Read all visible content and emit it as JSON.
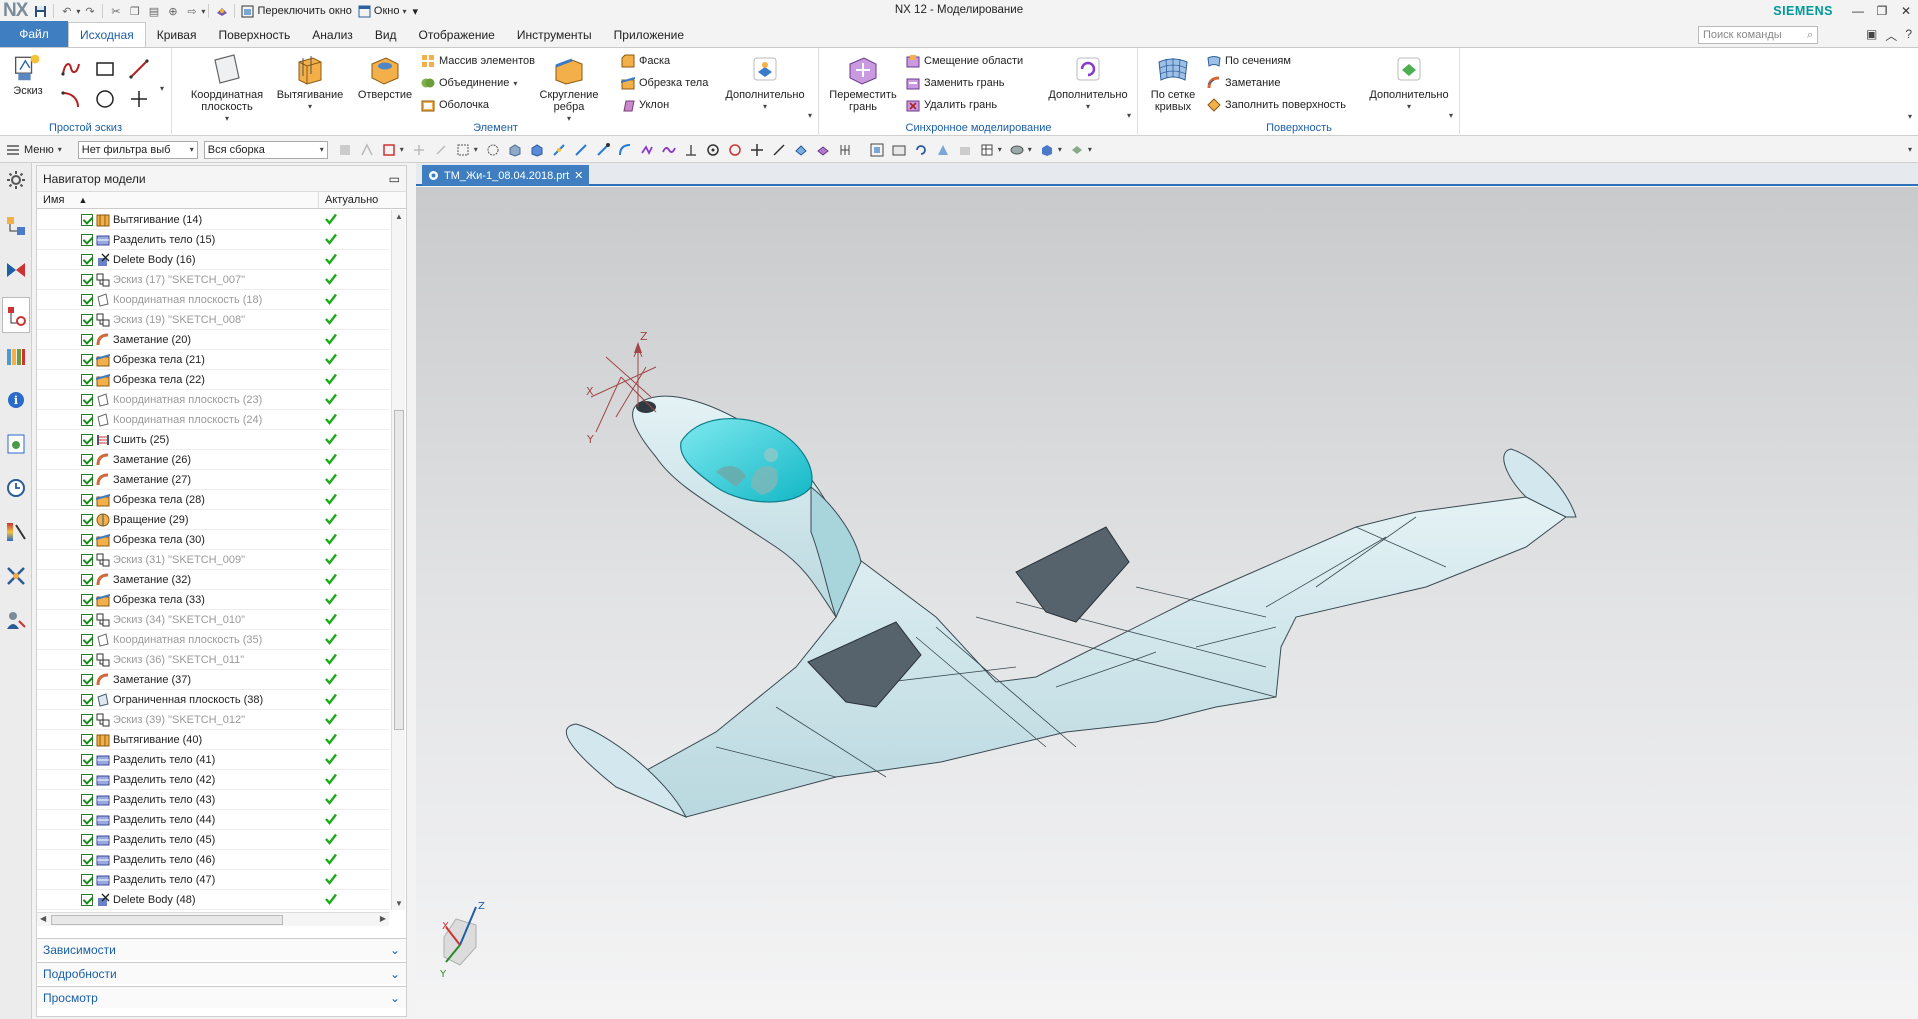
{
  "app": {
    "logo": "NX",
    "title": "NX 12 - Моделирование",
    "brand": "SIEMENS",
    "switch_window": "Переключить окно",
    "window_menu": "Окно"
  },
  "tabs": {
    "file": "Файл",
    "items": [
      "Исходная",
      "Кривая",
      "Поверхность",
      "Анализ",
      "Вид",
      "Отображение",
      "Инструменты",
      "Приложение"
    ],
    "active": "Исходная",
    "command_search_placeholder": "Поиск команды"
  },
  "ribbon": {
    "sketch_group": {
      "label": "Простой эскиз",
      "sketch_button": "Эскиз"
    },
    "feature_group": {
      "label": "Элемент",
      "datum_plane": "Координатная плоскость",
      "extrude": "Вытягивание",
      "hole": "Отверстие",
      "pattern": "Массив элементов",
      "unite": "Объединение",
      "shell": "Оболочка",
      "edge_blend": "Скругление ребра",
      "chamfer": "Фаска",
      "trim_body": "Обрезка тела",
      "draft": "Уклон",
      "more": "Дополнительно"
    },
    "sync_group": {
      "label": "Синхронное моделирование",
      "move_face": "Переместить грань",
      "offset_region": "Смещение области",
      "replace_face": "Заменить грань",
      "delete_face": "Удалить грань",
      "more": "Дополнительно"
    },
    "surface_group": {
      "label": "Поверхность",
      "through_curve_mesh": "По сетке кривых",
      "through_curves": "По сечениям",
      "swept": "Заметание",
      "fill_surface": "Заполнить поверхность",
      "more": "Дополнительно"
    }
  },
  "toolbar": {
    "menu": "Меню",
    "filter": "Нет фильтра выб",
    "assembly": "Вся сборка"
  },
  "navigator": {
    "title": "Навигатор модели",
    "col_name": "Имя",
    "col_current": "Актуально",
    "rows": [
      {
        "label": "Вытягивание (14)",
        "icon": "extrude",
        "dim": false
      },
      {
        "label": "Разделить тело (15)",
        "icon": "split",
        "dim": false
      },
      {
        "label": "Delete Body (16)",
        "icon": "delete",
        "dim": false
      },
      {
        "label": "Эскиз (17) \"SKETCH_007\"",
        "icon": "sketch",
        "dim": true
      },
      {
        "label": "Координатная плоскость (18)",
        "icon": "plane",
        "dim": true
      },
      {
        "label": "Эскиз (19) \"SKETCH_008\"",
        "icon": "sketch",
        "dim": true
      },
      {
        "label": "Заметание (20)",
        "icon": "swept",
        "dim": false
      },
      {
        "label": "Обрезка тела (21)",
        "icon": "trim",
        "dim": false
      },
      {
        "label": "Обрезка тела (22)",
        "icon": "trim",
        "dim": false
      },
      {
        "label": "Координатная плоскость (23)",
        "icon": "plane",
        "dim": true
      },
      {
        "label": "Координатная плоскость (24)",
        "icon": "plane",
        "dim": true
      },
      {
        "label": "Сшить (25)",
        "icon": "sew",
        "dim": false
      },
      {
        "label": "Заметание (26)",
        "icon": "swept",
        "dim": false
      },
      {
        "label": "Заметание (27)",
        "icon": "swept",
        "dim": false
      },
      {
        "label": "Обрезка тела (28)",
        "icon": "trim",
        "dim": false
      },
      {
        "label": "Вращение (29)",
        "icon": "revolve",
        "dim": false
      },
      {
        "label": "Обрезка тела (30)",
        "icon": "trim",
        "dim": false
      },
      {
        "label": "Эскиз (31) \"SKETCH_009\"",
        "icon": "sketch",
        "dim": true
      },
      {
        "label": "Заметание (32)",
        "icon": "swept",
        "dim": false
      },
      {
        "label": "Обрезка тела (33)",
        "icon": "trim",
        "dim": false
      },
      {
        "label": "Эскиз (34) \"SKETCH_010\"",
        "icon": "sketch",
        "dim": true
      },
      {
        "label": "Координатная плоскость (35)",
        "icon": "plane",
        "dim": true
      },
      {
        "label": "Эскиз (36) \"SKETCH_011\"",
        "icon": "sketch",
        "dim": true
      },
      {
        "label": "Заметание (37)",
        "icon": "swept",
        "dim": false
      },
      {
        "label": "Ограниченная плоскость (38)",
        "icon": "bplane",
        "dim": false
      },
      {
        "label": "Эскиз (39) \"SKETCH_012\"",
        "icon": "sketch",
        "dim": true
      },
      {
        "label": "Вытягивание (40)",
        "icon": "extrude",
        "dim": false
      },
      {
        "label": "Разделить тело (41)",
        "icon": "split",
        "dim": false
      },
      {
        "label": "Разделить тело (42)",
        "icon": "split",
        "dim": false
      },
      {
        "label": "Разделить тело (43)",
        "icon": "split",
        "dim": false
      },
      {
        "label": "Разделить тело (44)",
        "icon": "split",
        "dim": false
      },
      {
        "label": "Разделить тело (45)",
        "icon": "split",
        "dim": false
      },
      {
        "label": "Разделить тело (46)",
        "icon": "split",
        "dim": false
      },
      {
        "label": "Разделить тело (47)",
        "icon": "split",
        "dim": false
      },
      {
        "label": "Delete Body (48)",
        "icon": "delete",
        "dim": false
      }
    ],
    "panels": [
      "Зависимости",
      "Подробности",
      "Просмотр"
    ]
  },
  "document": {
    "tab": "TM_Жи-1_08.04.2018.prt"
  },
  "triad": {
    "x": "X",
    "y": "Y",
    "z": "Z"
  },
  "colors": {
    "accent": "#3f7fc1",
    "brand": "#009999",
    "canopy": "#19c9d6",
    "body": "#c9e3ea",
    "flap": "#56636c"
  }
}
